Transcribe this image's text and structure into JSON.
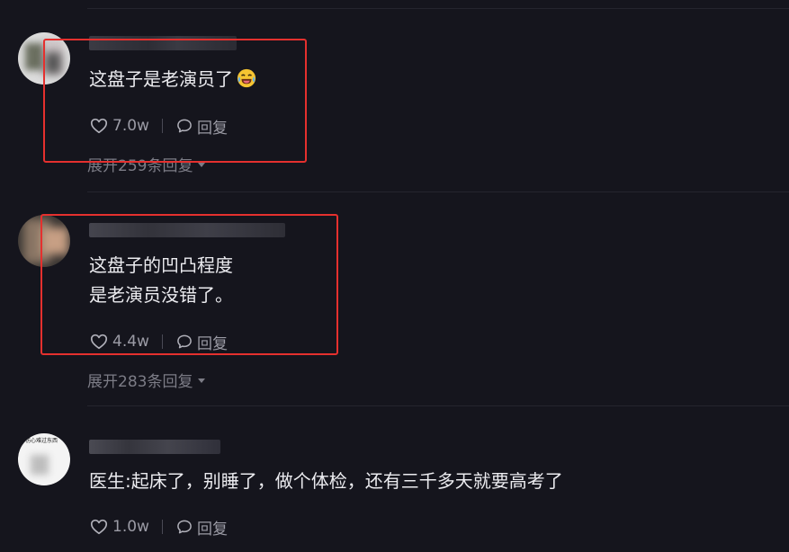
{
  "comments": [
    {
      "text": "这盘子是老演员了",
      "emoji": "laughing-crying-emoji",
      "likes": "7.0w",
      "reply_label": "回复",
      "expand_label": "展开259条回复"
    },
    {
      "text_line1": "这盘子的凹凸程度",
      "text_line2": "是老演员没错了。",
      "likes": "4.4w",
      "reply_label": "回复",
      "expand_label": "展开283条回复"
    },
    {
      "avatar_text": "伤心难过东西",
      "text": "医生:起床了，别睡了，做个体检，还有三千多天就要高考了",
      "likes": "1.0w",
      "reply_label": "回复"
    }
  ],
  "colors": {
    "background": "#15151d",
    "highlight_box": "#e5302e",
    "muted_text": "#9b9ba5"
  }
}
